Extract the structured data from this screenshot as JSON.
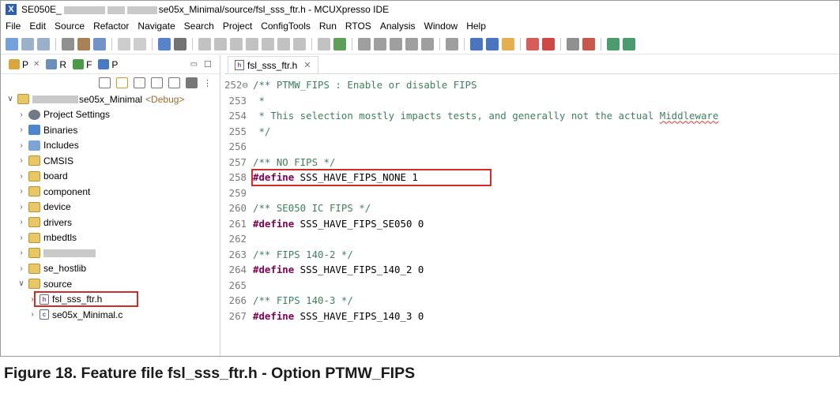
{
  "window": {
    "title_prefix": "SE050E_",
    "title_suffix": "se05x_Minimal/source/fsl_sss_ftr.h - MCUXpresso IDE",
    "app_icon_glyph": "X"
  },
  "menu": [
    "File",
    "Edit",
    "Source",
    "Refactor",
    "Navigate",
    "Search",
    "Project",
    "ConfigTools",
    "Run",
    "RTOS",
    "Analysis",
    "Window",
    "Help"
  ],
  "toolbar_icons": [
    {
      "name": "new-icon",
      "color": "#5c8fd6"
    },
    {
      "name": "save-icon",
      "color": "#8aa3c2"
    },
    {
      "name": "save-all-icon",
      "color": "#8aa3c2"
    },
    {
      "name": "sep"
    },
    {
      "name": "debug-settings-icon",
      "color": "#7d7d7d"
    },
    {
      "name": "build-icon",
      "color": "#9a6b3a"
    },
    {
      "name": "binary-icon",
      "color": "#5a7fbd"
    },
    {
      "name": "sep"
    },
    {
      "name": "back-icon",
      "color": "#c4c4c4"
    },
    {
      "name": "forward-icon",
      "color": "#c4c4c4"
    },
    {
      "name": "sep"
    },
    {
      "name": "terminal-icon",
      "color": "#3b6fc2"
    },
    {
      "name": "pointer-icon",
      "color": "#5a5a5a"
    },
    {
      "name": "sep"
    },
    {
      "name": "resume-icon",
      "color": "#b7b7b7"
    },
    {
      "name": "suspend-icon",
      "color": "#b7b7b7"
    },
    {
      "name": "terminate-icon",
      "color": "#b7b7b7"
    },
    {
      "name": "disconnect-icon",
      "color": "#b7b7b7"
    },
    {
      "name": "step-into-icon",
      "color": "#b7b7b7"
    },
    {
      "name": "step-over-icon",
      "color": "#b7b7b7"
    },
    {
      "name": "step-return-icon",
      "color": "#b7b7b7"
    },
    {
      "name": "sep"
    },
    {
      "name": "instruction-step-icon",
      "color": "#b7b7b7"
    },
    {
      "name": "mcu-icon",
      "color": "#3f8f3f"
    },
    {
      "name": "sep"
    },
    {
      "name": "flash-icon",
      "color": "#8e8e8e"
    },
    {
      "name": "peripheral-icon",
      "color": "#8e8e8e"
    },
    {
      "name": "registers-icon",
      "color": "#8e8e8e"
    },
    {
      "name": "memory-icon",
      "color": "#8e8e8e"
    },
    {
      "name": "trace-icon",
      "color": "#8e8e8e"
    },
    {
      "name": "sep"
    },
    {
      "name": "clear-icon",
      "color": "#8e8e8e"
    },
    {
      "name": "sep"
    },
    {
      "name": "mcux-icon",
      "color": "#2b5db5"
    },
    {
      "name": "info-icon",
      "color": "#2b5db5"
    },
    {
      "name": "home-icon",
      "color": "#e0a030"
    },
    {
      "name": "sep"
    },
    {
      "name": "link-icon",
      "color": "#d04040"
    },
    {
      "name": "probe-icon",
      "color": "#c62828"
    },
    {
      "name": "sep"
    },
    {
      "name": "external-tools-icon",
      "color": "#7d7d7d"
    },
    {
      "name": "debug-icon",
      "color": "#c0392b"
    },
    {
      "name": "sep"
    },
    {
      "name": "bug-icon",
      "color": "#2e8b57"
    },
    {
      "name": "bug-alt-icon",
      "color": "#2e8b57"
    }
  ],
  "left_panel": {
    "tabs": [
      {
        "label": "P",
        "icon": "project-explorer-icon",
        "color": "#d9a640"
      },
      {
        "label": "R",
        "icon": "registers-view-icon",
        "color": "#6b8fb8"
      },
      {
        "label": "F",
        "icon": "faults-view-icon",
        "color": "#4a9a4a"
      },
      {
        "label": "P",
        "icon": "peripherals-view-icon",
        "color": "#4a7ac0"
      }
    ],
    "tabs_close_glyph": "✕",
    "tree": [
      {
        "indent": 0,
        "twisty": "∨",
        "icon": "project",
        "label": "se05x_Minimal",
        "redacted": true,
        "suffix": "<Debug>"
      },
      {
        "indent": 1,
        "twisty": "›",
        "icon": "gear",
        "label": "Project Settings"
      },
      {
        "indent": 1,
        "twisty": "›",
        "icon": "bin",
        "label": "Binaries"
      },
      {
        "indent": 1,
        "twisty": "›",
        "icon": "inc",
        "label": "Includes"
      },
      {
        "indent": 1,
        "twisty": "›",
        "icon": "folder",
        "label": "CMSIS"
      },
      {
        "indent": 1,
        "twisty": "›",
        "icon": "folder",
        "label": "board"
      },
      {
        "indent": 1,
        "twisty": "›",
        "icon": "folder",
        "label": "component"
      },
      {
        "indent": 1,
        "twisty": "›",
        "icon": "folder",
        "label": "device"
      },
      {
        "indent": 1,
        "twisty": "›",
        "icon": "folder",
        "label": "drivers"
      },
      {
        "indent": 1,
        "twisty": "›",
        "icon": "folder",
        "label": "mbedtls"
      },
      {
        "indent": 1,
        "twisty": "›",
        "icon": "folder",
        "label": "",
        "redacted": true
      },
      {
        "indent": 1,
        "twisty": "›",
        "icon": "folder",
        "label": "se_hostlib"
      },
      {
        "indent": 1,
        "twisty": "∨",
        "icon": "folder",
        "label": "source"
      },
      {
        "indent": 2,
        "twisty": "›",
        "icon": "h",
        "label": "fsl_sss_ftr.h",
        "highlighted": true
      },
      {
        "indent": 2,
        "twisty": "›",
        "icon": "c",
        "label": "se05x_Minimal.c"
      }
    ]
  },
  "editor": {
    "tab_label": "fsl_sss_ftr.h",
    "tab_close": "✕",
    "lines": [
      {
        "num": "252⊖",
        "parts": [
          {
            "t": "/** PTMW_FIPS : Enable or disable FIPS",
            "c": "cm"
          }
        ]
      },
      {
        "num": "253",
        "parts": [
          {
            "t": " *",
            "c": "cm"
          }
        ]
      },
      {
        "num": "254",
        "parts": [
          {
            "t": " * This selection mostly impacts tests, and generally not the actual ",
            "c": "cm"
          },
          {
            "t": "Middleware",
            "c": "cm squiggle"
          }
        ]
      },
      {
        "num": "255",
        "parts": [
          {
            "t": " */",
            "c": "cm"
          }
        ]
      },
      {
        "num": "256",
        "parts": []
      },
      {
        "num": "257",
        "parts": [
          {
            "t": "/** NO FIPS */",
            "c": "cm"
          }
        ]
      },
      {
        "num": "258",
        "parts": [
          {
            "t": "#define",
            "c": "kw"
          },
          {
            "t": " SSS_HAVE_FIPS_NONE 1",
            "c": ""
          }
        ],
        "highlighted": true
      },
      {
        "num": "259",
        "parts": []
      },
      {
        "num": "260",
        "parts": [
          {
            "t": "/** SE050 IC FIPS */",
            "c": "cm"
          }
        ]
      },
      {
        "num": "261",
        "parts": [
          {
            "t": "#define",
            "c": "kw"
          },
          {
            "t": " SSS_HAVE_FIPS_SE050 0",
            "c": ""
          }
        ]
      },
      {
        "num": "262",
        "parts": []
      },
      {
        "num": "263",
        "parts": [
          {
            "t": "/** FIPS 140-2 */",
            "c": "cm"
          }
        ]
      },
      {
        "num": "264",
        "parts": [
          {
            "t": "#define",
            "c": "kw"
          },
          {
            "t": " SSS_HAVE_FIPS_140_2 0",
            "c": ""
          }
        ]
      },
      {
        "num": "265",
        "parts": []
      },
      {
        "num": "266",
        "parts": [
          {
            "t": "/** FIPS 140-3 */",
            "c": "cm"
          }
        ]
      },
      {
        "num": "267",
        "parts": [
          {
            "t": "#define",
            "c": "kw"
          },
          {
            "t": " SSS_HAVE_FIPS_140_3 0",
            "c": ""
          }
        ]
      }
    ]
  },
  "caption": "Figure 18.   Feature file fsl_sss_ftr.h - Option PTMW_FIPS",
  "colors": {
    "highlight_border": "#d32a2a",
    "comment": "#3f7f5f",
    "keyword": "#7f0055"
  }
}
